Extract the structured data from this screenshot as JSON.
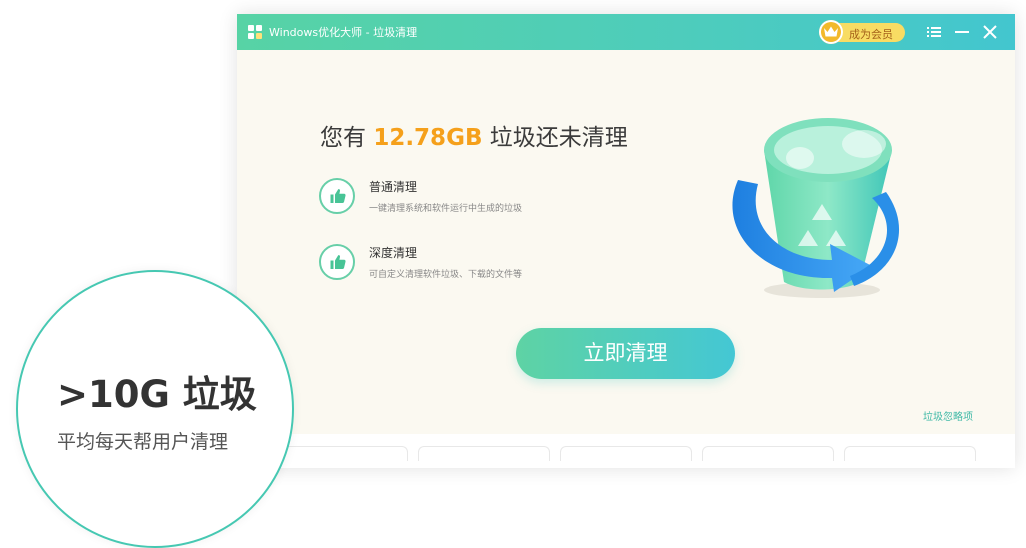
{
  "window": {
    "title": "Windows优化大师 - 垃圾清理",
    "vip_label": "成为会员"
  },
  "summary": {
    "prefix": "您有",
    "size": "12.78GB",
    "suffix": "垃圾还未清理"
  },
  "features": [
    {
      "title": "普通清理",
      "desc": "一键清理系统和软件运行中生成的垃圾",
      "icon": "thumbs-up-icon"
    },
    {
      "title": "深度清理",
      "desc": "可自定义清理软件垃圾、下载的文件等",
      "icon": "thumbs-up-icon"
    }
  ],
  "actions": {
    "clean_now": "立即清理",
    "ignore_items": "垃圾忽略项"
  },
  "promo": {
    "headline": ">10G 垃圾",
    "subline": "平均每天帮用户清理"
  },
  "colors": {
    "accent_green": "#57d3a5",
    "accent_teal": "#43c6cf",
    "highlight_orange": "#f5a01b"
  }
}
